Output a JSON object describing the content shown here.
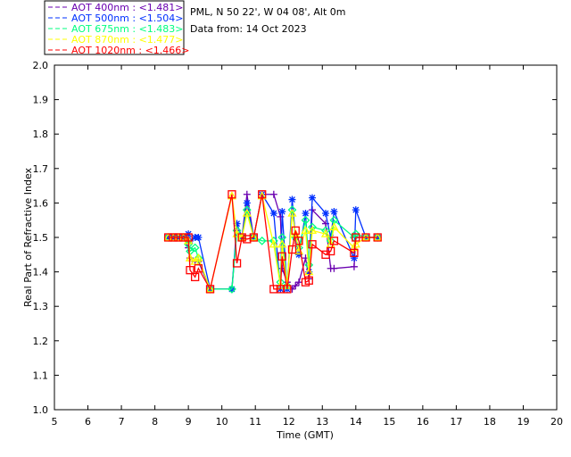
{
  "chart_data": {
    "type": "line",
    "header": {
      "line1": "PML, N 50 22', W 04 08', Alt 0m",
      "line2": "Data from: 14 Oct 2023"
    },
    "xlabel": "Time (GMT)",
    "ylabel": "Real Part of Refractive Index",
    "xlim": [
      5,
      20
    ],
    "ylim": [
      1.0,
      2.0
    ],
    "xticks": [
      "5",
      "6",
      "7",
      "8",
      "9",
      "10",
      "11",
      "12",
      "13",
      "14",
      "15",
      "16",
      "17",
      "18",
      "19",
      "20"
    ],
    "yticks": [
      "1.0",
      "1.1",
      "1.2",
      "1.3",
      "1.4",
      "1.5",
      "1.6",
      "1.7",
      "1.8",
      "1.9",
      "2.0"
    ],
    "legend_placement": "top-left outside",
    "x": [
      8.4,
      8.55,
      8.7,
      8.85,
      9.0,
      9.05,
      9.2,
      9.3,
      9.65,
      10.3,
      10.45,
      10.6,
      10.75,
      10.95,
      11.2,
      11.55,
      11.75,
      11.8,
      11.95,
      12.1,
      12.2,
      12.3,
      12.5,
      12.6,
      12.7,
      13.1,
      13.25,
      13.35,
      13.95,
      14.0,
      14.3,
      14.65
    ],
    "series": [
      {
        "name": "AOT  400nm : <1.481>",
        "color": "#6a00b0",
        "marker": "plus",
        "values": [
          1.5,
          1.5,
          1.5,
          1.5,
          1.47,
          1.44,
          1.43,
          1.43,
          1.35,
          1.35,
          1.52,
          1.5,
          1.625,
          1.5,
          1.625,
          1.625,
          1.56,
          1.41,
          1.37,
          1.35,
          1.36,
          1.37,
          1.44,
          1.38,
          1.58,
          1.54,
          1.41,
          1.41,
          1.415,
          1.5,
          1.5,
          1.5
        ]
      },
      {
        "name": "AOT  500nm : <1.504>",
        "color": "#0030ff",
        "marker": "star",
        "values": [
          1.5,
          1.5,
          1.5,
          1.5,
          1.51,
          1.49,
          1.5,
          1.5,
          1.35,
          1.35,
          1.54,
          1.5,
          1.6,
          1.5,
          1.625,
          1.57,
          1.35,
          1.575,
          1.35,
          1.61,
          1.5,
          1.45,
          1.57,
          1.4,
          1.615,
          1.57,
          1.5,
          1.575,
          1.44,
          1.58,
          1.5,
          1.5
        ]
      },
      {
        "name": "AOT  675nm : <1.483>",
        "color": "#00ff80",
        "marker": "diamond",
        "values": [
          1.5,
          1.5,
          1.5,
          1.5,
          1.48,
          1.46,
          1.47,
          1.44,
          1.35,
          1.35,
          1.52,
          1.5,
          1.58,
          1.5,
          1.49,
          1.49,
          1.37,
          1.5,
          1.36,
          1.58,
          1.5,
          1.47,
          1.55,
          1.42,
          1.53,
          1.52,
          1.49,
          1.55,
          1.5,
          1.51,
          1.5,
          1.5
        ]
      },
      {
        "name": "AOT  870nm : <1.477>",
        "color": "#ffff00",
        "marker": "triangle",
        "values": [
          1.5,
          1.5,
          1.5,
          1.5,
          1.49,
          1.44,
          1.43,
          1.44,
          1.35,
          1.62,
          1.51,
          1.5,
          1.57,
          1.5,
          1.62,
          1.48,
          1.36,
          1.48,
          1.36,
          1.57,
          1.51,
          1.46,
          1.52,
          1.4,
          1.52,
          1.51,
          1.48,
          1.53,
          1.47,
          1.48,
          1.5,
          1.5
        ]
      },
      {
        "name": "AOT 1020nm : <1.466>",
        "color": "#ff0000",
        "marker": "square",
        "values": [
          1.5,
          1.5,
          1.5,
          1.5,
          1.5,
          1.405,
          1.385,
          1.41,
          1.35,
          1.625,
          1.425,
          1.5,
          1.495,
          1.5,
          1.625,
          1.35,
          1.35,
          1.445,
          1.35,
          1.465,
          1.52,
          1.49,
          1.37,
          1.375,
          1.48,
          1.45,
          1.46,
          1.49,
          1.455,
          1.5,
          1.5,
          1.5
        ]
      }
    ]
  }
}
